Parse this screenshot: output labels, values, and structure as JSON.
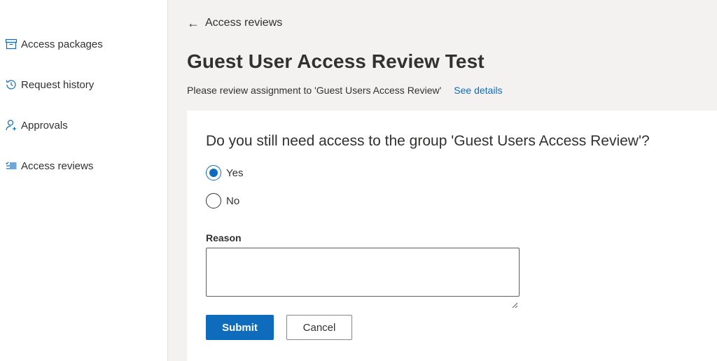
{
  "sidebar": {
    "items": [
      {
        "label": "Access packages",
        "icon": "package-icon"
      },
      {
        "label": "Request history",
        "icon": "history-icon"
      },
      {
        "label": "Approvals",
        "icon": "person-add-icon"
      },
      {
        "label": "Access reviews",
        "icon": "checklist-icon"
      }
    ]
  },
  "header": {
    "back_label": "Access reviews",
    "title": "Guest User Access Review Test",
    "subtitle": "Please review assignment to 'Guest Users Access Review'",
    "see_details": "See details"
  },
  "form": {
    "question": "Do you still need access to the group 'Guest Users Access Review'?",
    "options": [
      {
        "label": "Yes",
        "selected": true
      },
      {
        "label": "No",
        "selected": false
      }
    ],
    "reason_label": "Reason",
    "reason_value": "",
    "submit_label": "Submit",
    "cancel_label": "Cancel"
  },
  "colors": {
    "accent": "#0f6cbd",
    "main_background": "#f3f2f1",
    "text": "#323130"
  }
}
